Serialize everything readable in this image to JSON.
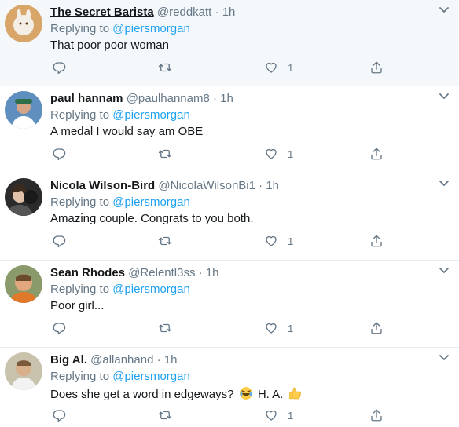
{
  "tweets": [
    {
      "name": "The Secret Barista",
      "handle": "@reddkatt",
      "dot": "·",
      "time": "1h",
      "replying_prefix": "Replying to",
      "replying_to": "@piersmorgan",
      "text": "That poor poor woman",
      "like_count": "1",
      "avatar_color": "#e8b87a"
    },
    {
      "name": "paul hannam",
      "handle": "@paulhannam8",
      "dot": "·",
      "time": "1h",
      "replying_prefix": "Replying to",
      "replying_to": "@piersmorgan",
      "text": "A medal I would say am OBE",
      "like_count": "1",
      "avatar_color": "#4a7db5"
    },
    {
      "name": "Nicola Wilson-Bird",
      "handle": "@NicolaWilsonBi1",
      "dot": "·",
      "time": "1h",
      "replying_prefix": "Replying to",
      "replying_to": "@piersmorgan",
      "text": "Amazing couple. Congrats to you both.",
      "like_count": "1",
      "avatar_color": "#3a3a3a"
    },
    {
      "name": "Sean Rhodes",
      "handle": "@Relentl3ss",
      "dot": "·",
      "time": "1h",
      "replying_prefix": "Replying to",
      "replying_to": "@piersmorgan",
      "text": "Poor girl...",
      "like_count": "1",
      "avatar_color": "#c78a5a"
    },
    {
      "name": "Big Al.",
      "handle": "@allanhand",
      "dot": "·",
      "time": "1h",
      "replying_prefix": "Replying to",
      "replying_to": "@piersmorgan",
      "text": "Does she get a word in edgeways?",
      "text_suffix": "H. A.",
      "like_count": "1",
      "avatar_color": "#b9a98a"
    }
  ],
  "colors": {
    "link": "#1da1f2",
    "muted": "#657786",
    "text": "#14171a",
    "divider": "#e6ecf0"
  },
  "icons": [
    "reply-icon",
    "retweet-icon",
    "like-icon",
    "share-icon",
    "caret-down-icon"
  ]
}
